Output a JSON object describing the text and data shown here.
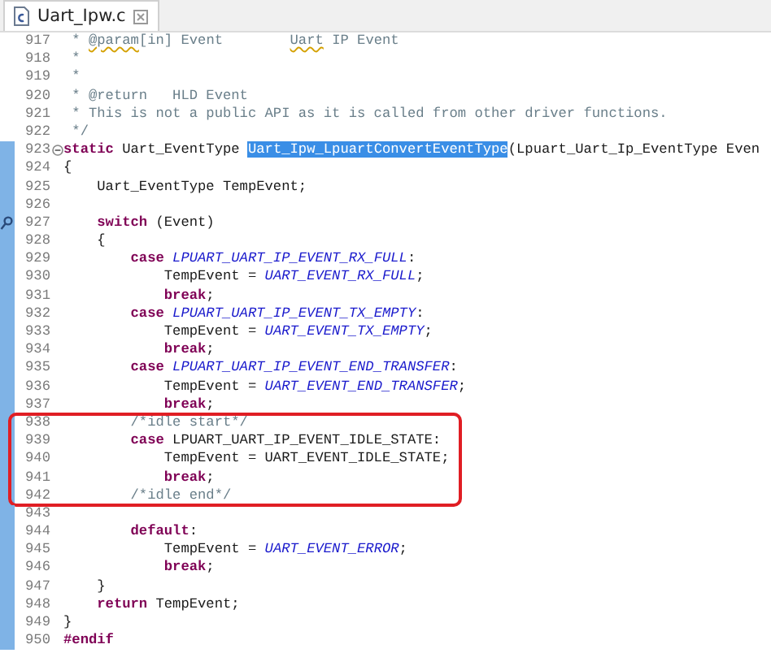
{
  "tabs": [
    {
      "label": "Uart_Ipw.c",
      "selected": true
    }
  ],
  "lines": [
    {
      "number": "917",
      "in_scope": false,
      "circled": false,
      "segments": [
        {
          "kind": "comment",
          "text": " * "
        },
        {
          "kind": "misspelled",
          "text": "@param"
        },
        {
          "kind": "comment",
          "text": "[in] Event        "
        },
        {
          "kind": "misspelled",
          "text": "Uart"
        },
        {
          "kind": "comment",
          "text": " IP Event"
        }
      ]
    },
    {
      "number": "918",
      "in_scope": false,
      "circled": false,
      "segments": [
        {
          "kind": "comment",
          "text": " *"
        }
      ]
    },
    {
      "number": "919",
      "in_scope": false,
      "circled": false,
      "segments": [
        {
          "kind": "comment",
          "text": " *"
        }
      ]
    },
    {
      "number": "920",
      "in_scope": false,
      "circled": false,
      "segments": [
        {
          "kind": "comment",
          "text": " * @return   HLD Event"
        }
      ]
    },
    {
      "number": "921",
      "in_scope": false,
      "circled": false,
      "segments": [
        {
          "kind": "comment",
          "text": " * This is not a public API as it is called from other driver functions."
        }
      ]
    },
    {
      "number": "922",
      "in_scope": false,
      "circled": false,
      "segments": [
        {
          "kind": "comment",
          "text": " */"
        }
      ]
    },
    {
      "number": "923",
      "in_scope": true,
      "circled": false,
      "foldable": true,
      "segments": [
        {
          "kind": "keyword",
          "text": "static"
        },
        {
          "kind": "plain",
          "text": " Uart_EventType "
        },
        {
          "kind": "selected",
          "text": "Uart_Ipw_LpuartConvertEventType"
        },
        {
          "kind": "plain",
          "text": "(Lpuart_Uart_Ip_EventType Even"
        }
      ]
    },
    {
      "number": "924",
      "in_scope": true,
      "circled": false,
      "segments": [
        {
          "kind": "plain",
          "text": "{"
        }
      ]
    },
    {
      "number": "925",
      "in_scope": true,
      "circled": false,
      "segments": [
        {
          "kind": "plain",
          "text": "    Uart_EventType TempEvent;"
        }
      ]
    },
    {
      "number": "926",
      "in_scope": true,
      "circled": false
    },
    {
      "number": "927",
      "in_scope": true,
      "circled": false,
      "marker": true,
      "segments": [
        {
          "kind": "keyword",
          "text": "    switch"
        },
        {
          "kind": "plain",
          "text": " (Event)"
        }
      ]
    },
    {
      "number": "928",
      "in_scope": true,
      "circled": false,
      "segments": [
        {
          "kind": "plain",
          "text": "    {"
        }
      ]
    },
    {
      "number": "929",
      "in_scope": true,
      "circled": false,
      "segments": [
        {
          "kind": "keyword",
          "text": "        case"
        },
        {
          "kind": "enum",
          "text": " LPUART_UART_IP_EVENT_RX_FULL"
        },
        {
          "kind": "plain",
          "text": ":"
        }
      ]
    },
    {
      "number": "930",
      "in_scope": true,
      "circled": false,
      "segments": [
        {
          "kind": "plain",
          "text": "            TempEvent = "
        },
        {
          "kind": "enum",
          "text": "UART_EVENT_RX_FULL"
        },
        {
          "kind": "plain",
          "text": ";"
        }
      ]
    },
    {
      "number": "931",
      "in_scope": true,
      "circled": false,
      "segments": [
        {
          "kind": "keyword",
          "text": "            break"
        },
        {
          "kind": "plain",
          "text": ";"
        }
      ]
    },
    {
      "number": "932",
      "in_scope": true,
      "circled": false,
      "segments": [
        {
          "kind": "keyword",
          "text": "        case"
        },
        {
          "kind": "enum",
          "text": " LPUART_UART_IP_EVENT_TX_EMPTY"
        },
        {
          "kind": "plain",
          "text": ":"
        }
      ]
    },
    {
      "number": "933",
      "in_scope": true,
      "circled": false,
      "segments": [
        {
          "kind": "plain",
          "text": "            TempEvent = "
        },
        {
          "kind": "enum",
          "text": "UART_EVENT_TX_EMPTY"
        },
        {
          "kind": "plain",
          "text": ";"
        }
      ]
    },
    {
      "number": "934",
      "in_scope": true,
      "circled": false,
      "segments": [
        {
          "kind": "keyword",
          "text": "            break"
        },
        {
          "kind": "plain",
          "text": ";"
        }
      ]
    },
    {
      "number": "935",
      "in_scope": true,
      "circled": false,
      "segments": [
        {
          "kind": "keyword",
          "text": "        case"
        },
        {
          "kind": "enum",
          "text": " LPUART_UART_IP_EVENT_END_TRANSFER"
        },
        {
          "kind": "plain",
          "text": ":"
        }
      ]
    },
    {
      "number": "936",
      "in_scope": true,
      "circled": false,
      "segments": [
        {
          "kind": "plain",
          "text": "            TempEvent = "
        },
        {
          "kind": "enum",
          "text": "UART_EVENT_END_TRANSFER"
        },
        {
          "kind": "plain",
          "text": ";"
        }
      ]
    },
    {
      "number": "937",
      "in_scope": true,
      "circled": false,
      "segments": [
        {
          "kind": "keyword",
          "text": "            break"
        },
        {
          "kind": "plain",
          "text": ";"
        }
      ]
    },
    {
      "number": "938",
      "in_scope": true,
      "circled": true,
      "segments": [
        {
          "kind": "comment",
          "text": "        /*idle start*/"
        }
      ]
    },
    {
      "number": "939",
      "in_scope": true,
      "circled": true,
      "segments": [
        {
          "kind": "keyword",
          "text": "        case"
        },
        {
          "kind": "plain",
          "text": " LPUART_UART_IP_EVENT_IDLE_STATE:"
        }
      ]
    },
    {
      "number": "940",
      "in_scope": true,
      "circled": true,
      "segments": [
        {
          "kind": "plain",
          "text": "            TempEvent = UART_EVENT_IDLE_STATE;"
        }
      ]
    },
    {
      "number": "941",
      "in_scope": true,
      "circled": true,
      "segments": [
        {
          "kind": "keyword",
          "text": "            break"
        },
        {
          "kind": "plain",
          "text": ";"
        }
      ]
    },
    {
      "number": "942",
      "in_scope": true,
      "circled": true,
      "segments": [
        {
          "kind": "comment",
          "text": "        /*idle end*/"
        }
      ]
    },
    {
      "number": "943",
      "in_scope": true,
      "circled": false
    },
    {
      "number": "944",
      "in_scope": true,
      "circled": false,
      "segments": [
        {
          "kind": "keyword",
          "text": "        default"
        },
        {
          "kind": "plain",
          "text": ":"
        }
      ]
    },
    {
      "number": "945",
      "in_scope": true,
      "circled": false,
      "segments": [
        {
          "kind": "plain",
          "text": "            TempEvent = "
        },
        {
          "kind": "enum",
          "text": "UART_EVENT_ERROR"
        },
        {
          "kind": "plain",
          "text": ";"
        }
      ]
    },
    {
      "number": "946",
      "in_scope": true,
      "circled": false,
      "segments": [
        {
          "kind": "keyword",
          "text": "            break"
        },
        {
          "kind": "plain",
          "text": ";"
        }
      ]
    },
    {
      "number": "947",
      "in_scope": true,
      "circled": false,
      "segments": [
        {
          "kind": "plain",
          "text": "    }"
        }
      ]
    },
    {
      "number": "948",
      "in_scope": true,
      "circled": false,
      "segments": [
        {
          "kind": "keyword",
          "text": "    return"
        },
        {
          "kind": "plain",
          "text": " TempEvent;"
        }
      ]
    },
    {
      "number": "949",
      "in_scope": true,
      "circled": false,
      "segments": [
        {
          "kind": "plain",
          "text": "}"
        }
      ]
    },
    {
      "number": "950",
      "in_scope": true,
      "circled": false,
      "segments": [
        {
          "kind": "keyword",
          "text": "#endif"
        }
      ]
    }
  ]
}
